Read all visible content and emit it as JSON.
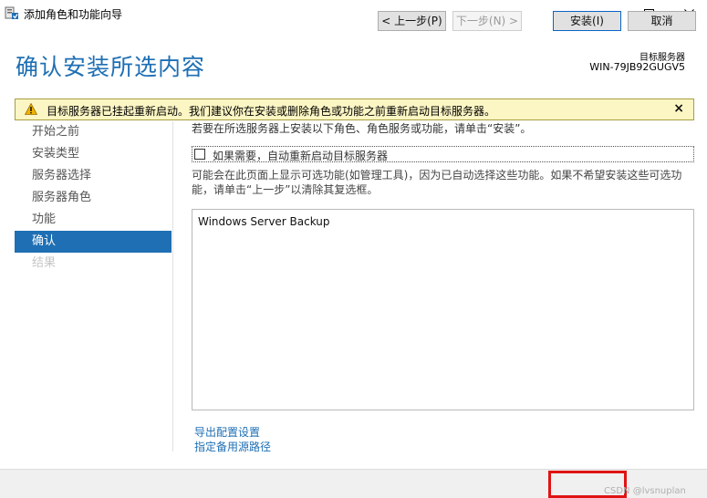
{
  "window": {
    "title": "添加角色和功能向导",
    "icons": {
      "app": "server-manager-icon",
      "minimize": "minimize-icon",
      "maximize": "maximize-icon",
      "close": "close-icon"
    }
  },
  "header": {
    "page_title": "确认安装所选内容",
    "server_label": "目标服务器",
    "server_name": "WIN-79JB92GUGV5"
  },
  "warning": {
    "text": "目标服务器已挂起重新启动。我们建议你在安装或删除角色或功能之前重新启动目标服务器。",
    "close": "×",
    "icon": "warning-icon"
  },
  "nav": {
    "items": [
      {
        "label": "开始之前",
        "state": "normal"
      },
      {
        "label": "安装类型",
        "state": "normal"
      },
      {
        "label": "服务器选择",
        "state": "normal"
      },
      {
        "label": "服务器角色",
        "state": "normal"
      },
      {
        "label": "功能",
        "state": "normal"
      },
      {
        "label": "确认",
        "state": "active"
      },
      {
        "label": "结果",
        "state": "disabled"
      }
    ]
  },
  "main": {
    "intro": "若要在所选服务器上安装以下角色、角色服务或功能，请单击“安装”。",
    "restart_label": "如果需要，自动重新启动目标服务器",
    "restart_checked": false,
    "description": "可能会在此页面上显示可选功能(如管理工具)，因为已自动选择这些功能。如果不希望安装这些可选功能，请单击“上一步”以清除其复选框。",
    "features": [
      "Windows Server Backup"
    ],
    "export_link": "导出配置设置",
    "alt_source_link": "指定备用源路径"
  },
  "footer": {
    "prev": "< 上一步(P)",
    "next": "下一步(N) >",
    "install": "安装(I)",
    "cancel": "取消"
  },
  "watermark": "CSDN @lvsnuplan"
}
